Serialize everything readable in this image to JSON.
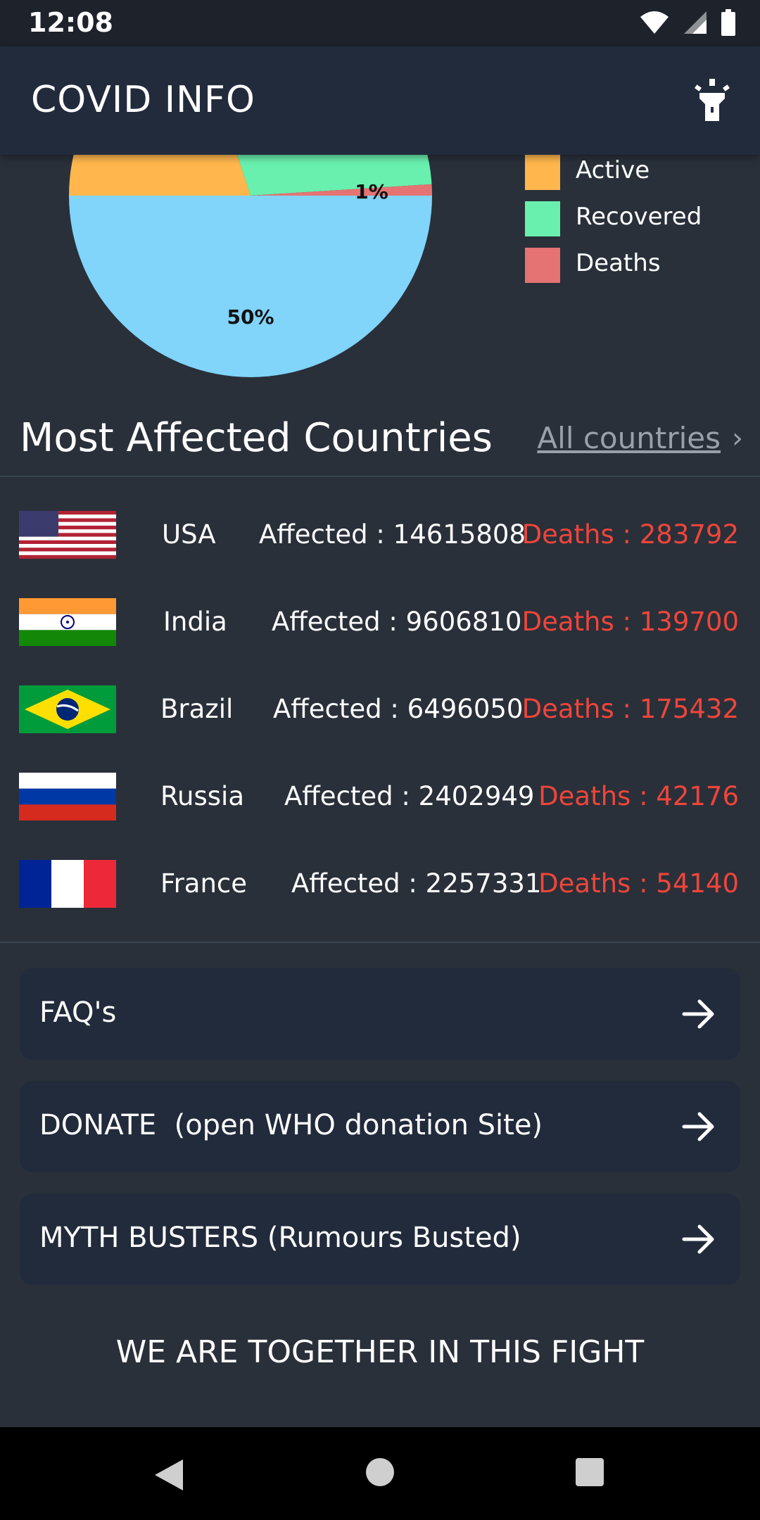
{
  "status_bar": {
    "time": "12:08",
    "icons": [
      "wifi-icon",
      "signal-icon",
      "battery-icon"
    ]
  },
  "app_bar": {
    "title": "COVID INFO",
    "action_icon": "flashlight-icon"
  },
  "chart_data": {
    "type": "pie",
    "slices": [
      {
        "label": "Active",
        "percent": 20,
        "color": "#ffb74d"
      },
      {
        "label": "Recovered",
        "percent": 29,
        "color": "#69f0ae"
      },
      {
        "label": "Deaths",
        "percent": 1,
        "color": "#e57373",
        "data_label": "1%"
      },
      {
        "label": "Affected",
        "percent": 50,
        "color": "#81d4fa",
        "data_label": "50%"
      }
    ],
    "legend": [
      "Active",
      "Recovered",
      "Deaths"
    ],
    "legend_placement": "right"
  },
  "section": {
    "title": "Most Affected Countries",
    "link_label": "All countries",
    "link_chevron": "›"
  },
  "countries": [
    {
      "name": "USA",
      "affected": "Affected : 14615808",
      "deaths": "Deaths : 283792",
      "flag": "usa-flag"
    },
    {
      "name": "India",
      "affected": "Affected : 9606810",
      "deaths": "Deaths : 139700",
      "flag": "india-flag"
    },
    {
      "name": "Brazil",
      "affected": "Affected : 6496050",
      "deaths": "Deaths : 175432",
      "flag": "brazil-flag"
    },
    {
      "name": "Russia",
      "affected": "Affected : 2402949",
      "deaths": "Deaths : 42176",
      "flag": "russia-flag"
    },
    {
      "name": "France",
      "affected": "Affected : 2257331",
      "deaths": "Deaths : 54140",
      "flag": "france-flag"
    }
  ],
  "cards": [
    {
      "label": "FAQ's",
      "icon": "arrow-right-icon"
    },
    {
      "label": "DONATE  (open WHO donation Site)",
      "icon": "arrow-right-icon"
    },
    {
      "label": "MYTH BUSTERS (Rumours Busted)",
      "icon": "arrow-right-icon"
    }
  ],
  "footer": {
    "text": "WE ARE TOGETHER IN THIS FIGHT"
  },
  "colors": {
    "background": "#29303a",
    "app_bar": "#222b3b",
    "deaths_text": "#f0453a",
    "card": "#222b3b"
  }
}
